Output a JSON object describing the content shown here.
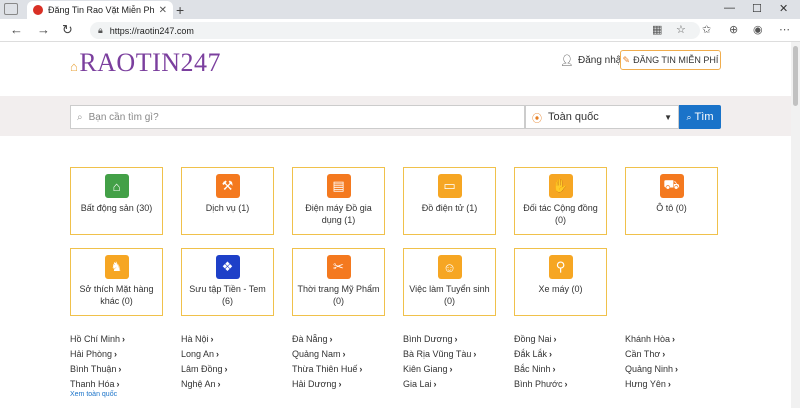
{
  "browser": {
    "tab_title": "Đăng Tin Rao Vặt Miễn Phí Toà",
    "url": "https://raotin247.com"
  },
  "header": {
    "logo": "RAOTIN247",
    "login": "Đăng nhập",
    "post_button": "ĐĂNG TIN MIỄN PHÍ"
  },
  "search": {
    "placeholder": "Bạn cần tìm gì?",
    "location": "Toàn quốc",
    "button": "Tìm"
  },
  "categories": [
    {
      "label": "Bất động sản (30)",
      "icon": "house-icon",
      "color": "#43a047"
    },
    {
      "label": "Dịch vụ (1)",
      "icon": "service-icon",
      "color": "#f4791f"
    },
    {
      "label": "Điện máy Đồ gia dụng (1)",
      "icon": "appliance-icon",
      "color": "#f4791f"
    },
    {
      "label": "Đồ điện tử (1)",
      "icon": "tv-icon",
      "color": "#f6a623"
    },
    {
      "label": "Đối tác Cộng đồng (0)",
      "icon": "handshake-icon",
      "color": "#f6a623"
    },
    {
      "label": "Ô tô (0)",
      "icon": "car-icon",
      "color": "#f4791f"
    },
    {
      "label": "Sở thích Mặt hàng khác (0)",
      "icon": "hobby-icon",
      "color": "#f6a623"
    },
    {
      "label": "Sưu tập Tiền - Tem (6)",
      "icon": "collection-icon",
      "color": "#1e40c8"
    },
    {
      "label": "Thời trang Mỹ Phẩm (0)",
      "icon": "fashion-icon",
      "color": "#f4791f"
    },
    {
      "label": "Việc làm Tuyển sinh (0)",
      "icon": "jobs-icon",
      "color": "#f6a623"
    },
    {
      "label": "Xe máy (0)",
      "icon": "motorbike-icon",
      "color": "#f6a623"
    }
  ],
  "cities": [
    [
      "Hồ Chí Minh",
      "Hà Nội",
      "Đà Nẵng",
      "Bình Dương",
      "Đồng Nai",
      "Khánh Hòa"
    ],
    [
      "Hải Phòng",
      "Long An",
      "Quảng Nam",
      "Bà Rịa Vũng Tàu",
      "Đắk Lắk",
      "Cần Thơ"
    ],
    [
      "Bình Thuận",
      "Lâm Đồng",
      "Thừa Thiên Huế",
      "Kiên Giang",
      "Bắc Ninh",
      "Quảng Ninh"
    ],
    [
      "Thanh Hóa",
      "Nghệ An",
      "Hải Dương",
      "Gia Lai",
      "Bình Phước",
      "Hưng Yên"
    ]
  ],
  "more_link": "Xem toàn quốc"
}
